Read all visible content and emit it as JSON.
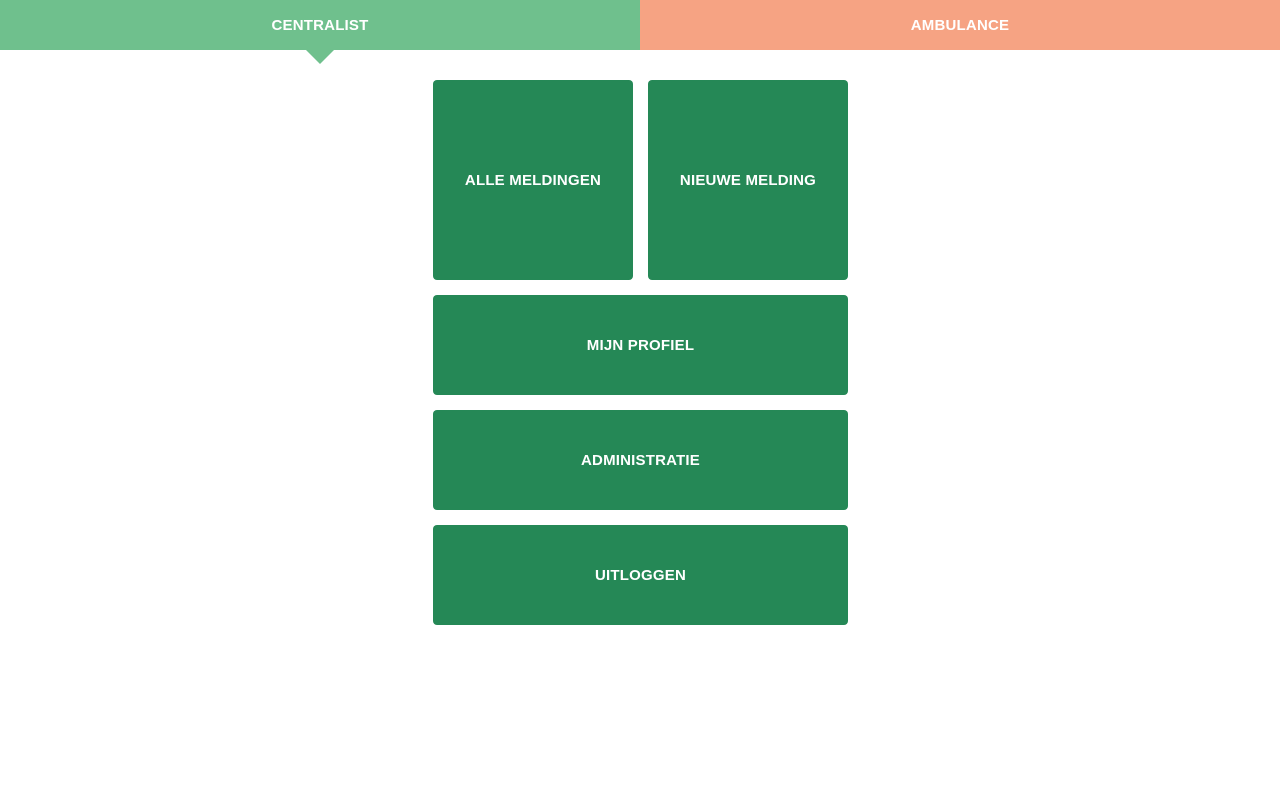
{
  "topbar": {
    "tabs": [
      {
        "label": "CENTRALIST",
        "color": "#6fc08d",
        "active": true
      },
      {
        "label": "AMBULANCE",
        "color": "#f6a383",
        "active": false
      }
    ]
  },
  "menu": {
    "tile_color": "#258856",
    "all_reports_label": "ALLE MELDINGEN",
    "new_report_label": "NIEUWE MELDING",
    "profile_label": "MIJN PROFIEL",
    "admin_label": "ADMINISTRATIE",
    "logout_label": "UITLOGGEN"
  }
}
